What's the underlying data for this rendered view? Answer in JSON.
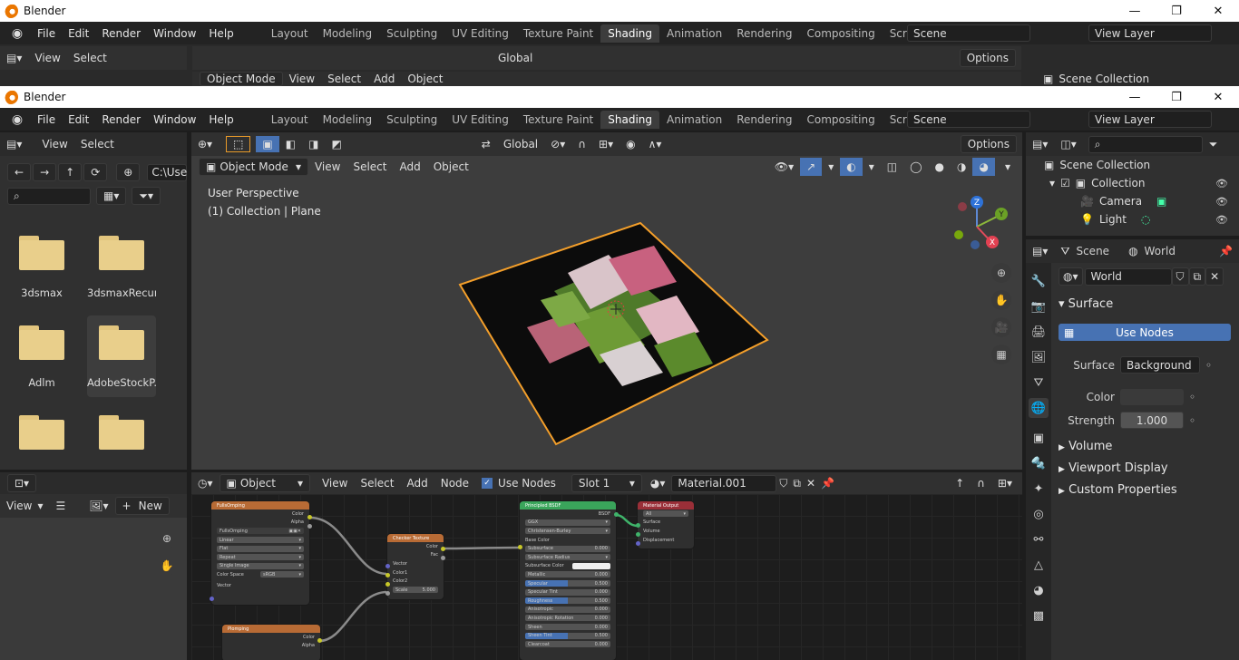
{
  "app": {
    "title": "Blender",
    "window_controls": [
      "—",
      "❐",
      "✕"
    ]
  },
  "menu": [
    "File",
    "Edit",
    "Render",
    "Window",
    "Help"
  ],
  "workspace_tabs": [
    "Layout",
    "Modeling",
    "Sculpting",
    "UV Editing",
    "Texture Paint",
    "Shading",
    "Animation",
    "Rendering",
    "Compositing",
    "Scripting"
  ],
  "active_tab": "Shading",
  "scene": {
    "label": "Scene",
    "view_layer": "View Layer"
  },
  "file_browser": {
    "header": [
      "View",
      "Select"
    ],
    "path": "C:\\Use",
    "items": [
      {
        "name": "3dsmax"
      },
      {
        "name": "3dsmaxRecur..."
      },
      {
        "name": "Adlm"
      },
      {
        "name": "AdobeStockP..."
      },
      {
        "name": ""
      },
      {
        "name": ""
      }
    ]
  },
  "viewport": {
    "toolbar_orientation": "Global",
    "options_label": "Options",
    "mode": "Object Mode",
    "menus": [
      "View",
      "Select",
      "Add",
      "Object"
    ],
    "overlay_title": "User Perspective",
    "overlay_sub": "(1) Collection | Plane",
    "gizmo": {
      "x": "X",
      "y": "Y",
      "z": "Z"
    }
  },
  "outliner": {
    "root": "Scene Collection",
    "collection": "Collection",
    "items": [
      "Camera",
      "Light"
    ]
  },
  "properties": {
    "tabs": [
      "Scene",
      "World"
    ],
    "world_name": "World",
    "surface_header": "Surface",
    "use_nodes_btn": "Use Nodes",
    "surface_label": "Surface",
    "surface_value": "Background",
    "color_label": "Color",
    "strength_label": "Strength",
    "strength_value": "1.000",
    "sections": [
      "Volume",
      "Viewport Display",
      "Custom Properties"
    ]
  },
  "image_editor": {
    "view": "View",
    "new_btn": "New"
  },
  "node_editor": {
    "type": "Object",
    "menus": [
      "View",
      "Select",
      "Add",
      "Node"
    ],
    "use_nodes": "Use Nodes",
    "slot": "Slot 1",
    "material": "Material.001",
    "nodes": {
      "img1": {
        "title": "FullsOmping",
        "outs": [
          "Color",
          "Alpha"
        ],
        "file": "FullsOmping",
        "rows": [
          "Linear",
          "Flat",
          "Repeat",
          "Single Image"
        ],
        "cs_label": "Color Space",
        "cs_value": "sRGB",
        "vec": "Vector"
      },
      "img2": {
        "title": "Plomping",
        "outs": [
          "Color",
          "Alpha"
        ]
      },
      "checker": {
        "title": "Checker Texture",
        "outs": [
          "Color",
          "Fac"
        ],
        "ins": [
          "Vector",
          "Color1",
          "Color2"
        ],
        "scale_label": "Scale",
        "scale_value": "5.000"
      },
      "bsdf": {
        "title": "Principled BSDF",
        "out": "BSDF",
        "dist": "GGX",
        "ss": "Christensen-Burley",
        "rows": [
          {
            "l": "Base Color",
            "v": ""
          },
          {
            "l": "Subsurface",
            "v": "0.000"
          },
          {
            "l": "Subsurface Radius",
            "v": ""
          },
          {
            "l": "Subsurface Color",
            "v": ""
          },
          {
            "l": "Metallic",
            "v": "0.000"
          },
          {
            "l": "Specular",
            "v": "0.500"
          },
          {
            "l": "Specular Tint",
            "v": "0.000"
          },
          {
            "l": "Roughness",
            "v": "0.500"
          },
          {
            "l": "Anisotropic",
            "v": "0.000"
          },
          {
            "l": "Anisotropic Rotation",
            "v": "0.000"
          },
          {
            "l": "Sheen",
            "v": "0.000"
          },
          {
            "l": "Sheen Tint",
            "v": "0.500"
          },
          {
            "l": "Clearcoat",
            "v": "0.000"
          }
        ]
      },
      "output": {
        "title": "Material Output",
        "target": "All",
        "ins": [
          "Surface",
          "Volume",
          "Displacement"
        ]
      }
    }
  },
  "colors": {
    "accent": "#4772b3",
    "selection": "#f49f2a",
    "folder": "#e9cf8b"
  }
}
